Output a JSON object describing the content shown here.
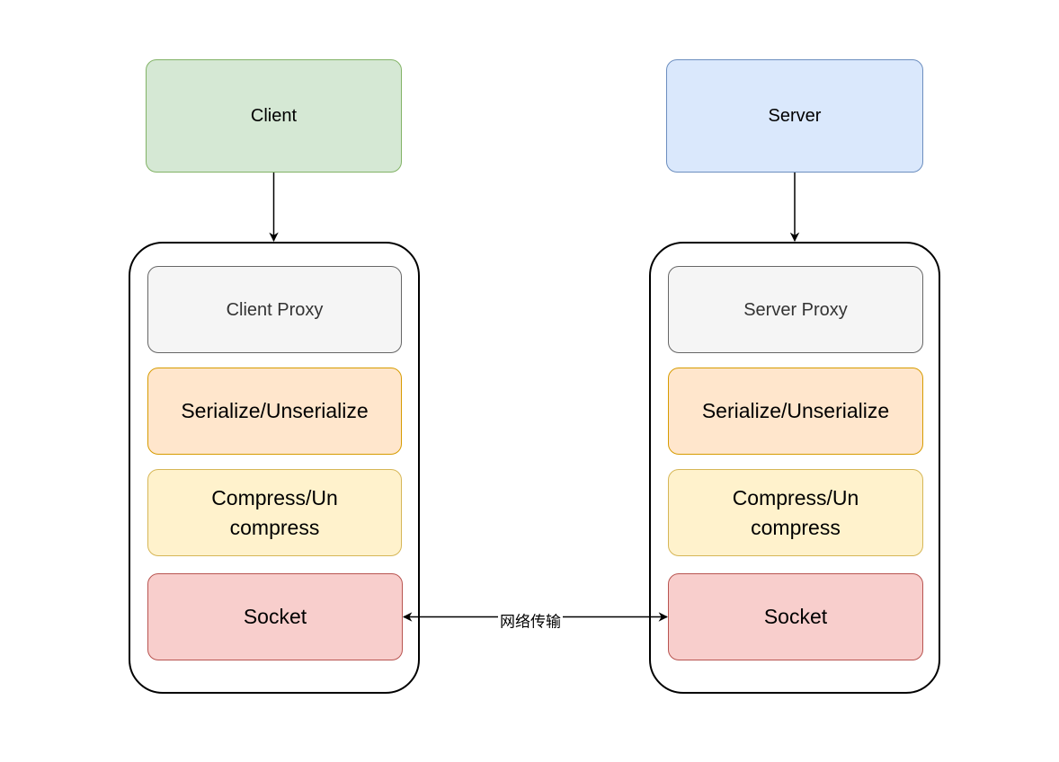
{
  "diagram": {
    "colors": {
      "client": {
        "fill": "#d5e8d4",
        "stroke": "#82b366"
      },
      "server": {
        "fill": "#dae8fc",
        "stroke": "#6c8ebf"
      },
      "proxy": {
        "fill": "#f5f5f5",
        "stroke": "#666666",
        "text": "#333333"
      },
      "serialize": {
        "fill": "#ffe6cc",
        "stroke": "#d79b00"
      },
      "compress": {
        "fill": "#fff2cc",
        "stroke": "#d6b656"
      },
      "socket": {
        "fill": "#f8cecc",
        "stroke": "#b85450"
      }
    },
    "client_side": {
      "top_node": "Client",
      "layers": [
        "Client Proxy",
        "Serialize/Unserialize",
        "Compress/Un compress",
        "Socket"
      ]
    },
    "server_side": {
      "top_node": "Server",
      "layers": [
        "Server Proxy",
        "Serialize/Unserialize",
        "Compress/Un compress",
        "Socket"
      ]
    },
    "compress_line1": "Compress/Un",
    "compress_line2": "compress",
    "network_label": "网络传输"
  }
}
